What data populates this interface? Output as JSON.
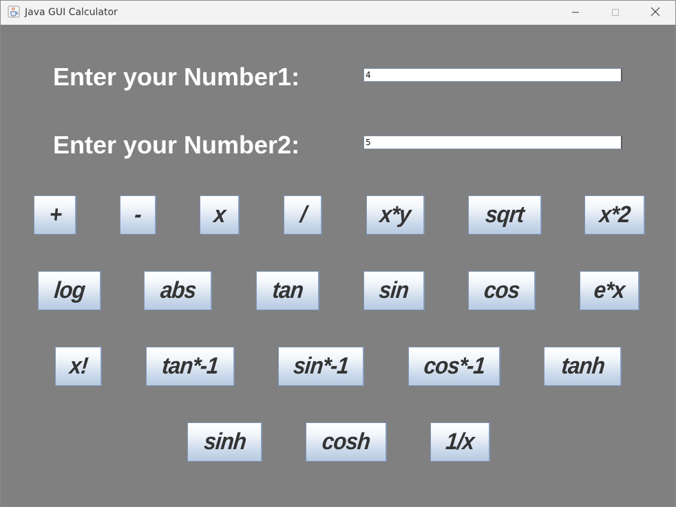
{
  "window": {
    "title": "Java GUI Calculator",
    "icons": {
      "app": "java-cup-icon",
      "minimize": "minimize-icon",
      "maximize": "maximize-icon",
      "close": "close-icon"
    }
  },
  "colors": {
    "background": "#808080",
    "label_text": "#ffffff",
    "button_text": "#333333",
    "button_gradient_top": "#ffffff",
    "button_gradient_bottom": "#b7cbe2"
  },
  "form": {
    "number1_label": "Enter your Number1:",
    "number1_value": "4",
    "number2_label": "Enter your Number2:",
    "number2_value": "5"
  },
  "buttons": {
    "row1": [
      "+",
      "-",
      "x",
      "/",
      "x*y",
      "sqrt",
      "x*2"
    ],
    "row2": [
      "log",
      "abs",
      "tan",
      "sin",
      "cos",
      "e*x"
    ],
    "row3": [
      "x!",
      "tan*-1",
      "sin*-1",
      "cos*-1",
      "tanh"
    ],
    "row4": [
      "sinh",
      "cosh",
      "1/x"
    ]
  }
}
